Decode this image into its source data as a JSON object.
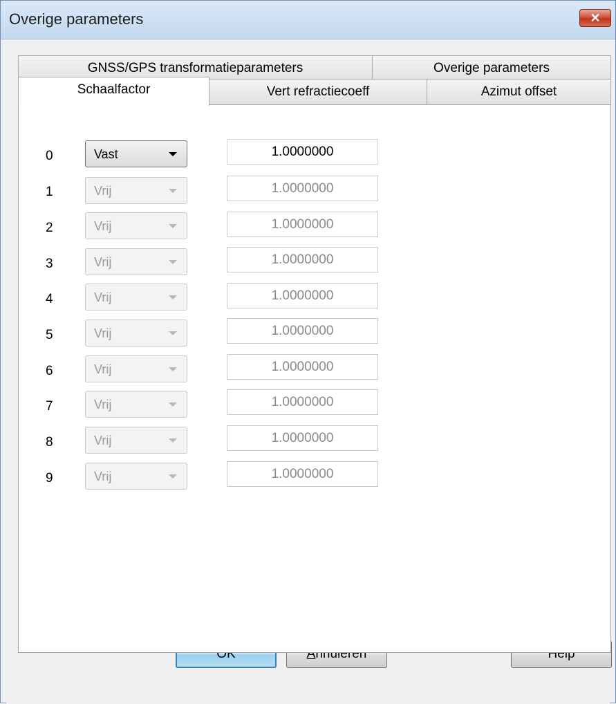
{
  "window": {
    "title": "Overige parameters",
    "close_symbol": "✕"
  },
  "tabs": {
    "back_row": [
      {
        "label": "GNSS/GPS transformatieparameters"
      },
      {
        "label": "Overige parameters"
      }
    ],
    "front_row": [
      {
        "label": "Schaalfactor",
        "selected": true
      },
      {
        "label": "Vert refractiecoeff"
      },
      {
        "label": "Azimut offset"
      }
    ]
  },
  "rows": [
    {
      "index": "0",
      "mode": "Vast",
      "value": "1.0000000"
    },
    {
      "index": "1",
      "mode": "Vrij",
      "value": "1.0000000"
    },
    {
      "index": "2",
      "mode": "Vrij",
      "value": "1.0000000"
    },
    {
      "index": "3",
      "mode": "Vrij",
      "value": "1.0000000"
    },
    {
      "index": "4",
      "mode": "Vrij",
      "value": "1.0000000"
    },
    {
      "index": "5",
      "mode": "Vrij",
      "value": "1.0000000"
    },
    {
      "index": "6",
      "mode": "Vrij",
      "value": "1.0000000"
    },
    {
      "index": "7",
      "mode": "Vrij",
      "value": "1.0000000"
    },
    {
      "index": "8",
      "mode": "Vrij",
      "value": "1.0000000"
    },
    {
      "index": "9",
      "mode": "Vrij",
      "value": "1.0000000"
    }
  ],
  "buttons": {
    "ok": "OK",
    "cancel": "Annuleren",
    "help": "Help"
  }
}
